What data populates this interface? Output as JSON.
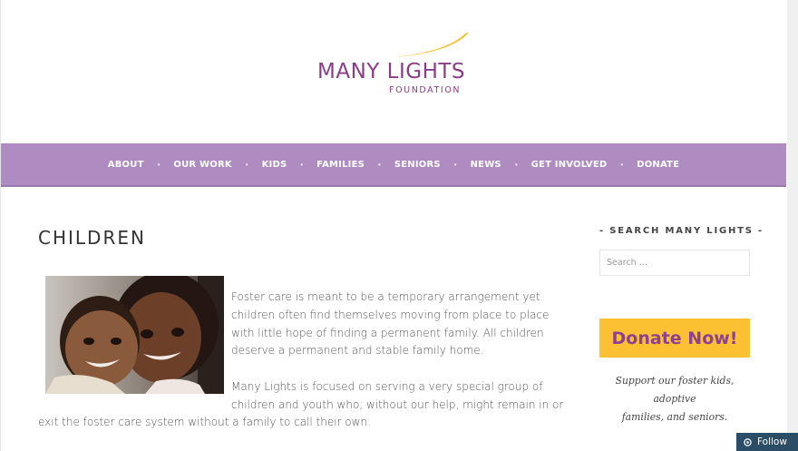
{
  "logo": {
    "name": "MANY LIGHTS",
    "subtitle": "FOUNDATION",
    "brand_color": "#8a3d86",
    "swoosh_color": "#f7c12e"
  },
  "nav": {
    "background": "#ae8cc2",
    "items": [
      {
        "label": "ABOUT"
      },
      {
        "label": "OUR WORK"
      },
      {
        "label": "KIDS"
      },
      {
        "label": "FAMILIES"
      },
      {
        "label": "SENIORS"
      },
      {
        "label": "NEWS"
      },
      {
        "label": "GET INVOLVED"
      },
      {
        "label": "DONATE"
      }
    ],
    "separator": "•"
  },
  "main": {
    "title": "CHILDREN",
    "paragraph1": [
      "Foster care is meant to be a temporary arrangement yet",
      "children often find themselves moving from place to place",
      "with little hope of finding a permanent family. All children",
      "deserve a permanent and stable family home."
    ],
    "paragraph2": [
      "Many Lights is focused on serving a very special group of",
      "children and youth who, without our help, might remain in or",
      "exit the foster care system without a family to call their own."
    ]
  },
  "sidebar": {
    "search_heading": "- SEARCH MANY LIGHTS -",
    "search_placeholder": "Search …",
    "donate_label": "Donate Now!",
    "donate_bg": "#fcc133",
    "donate_text_color": "#8e4092",
    "support_lines": [
      "Support our foster kids, adoptive",
      "families, and seniors."
    ]
  },
  "follow": {
    "label": "Follow",
    "icon": "wordpress-icon",
    "background": "#2b4d65"
  }
}
